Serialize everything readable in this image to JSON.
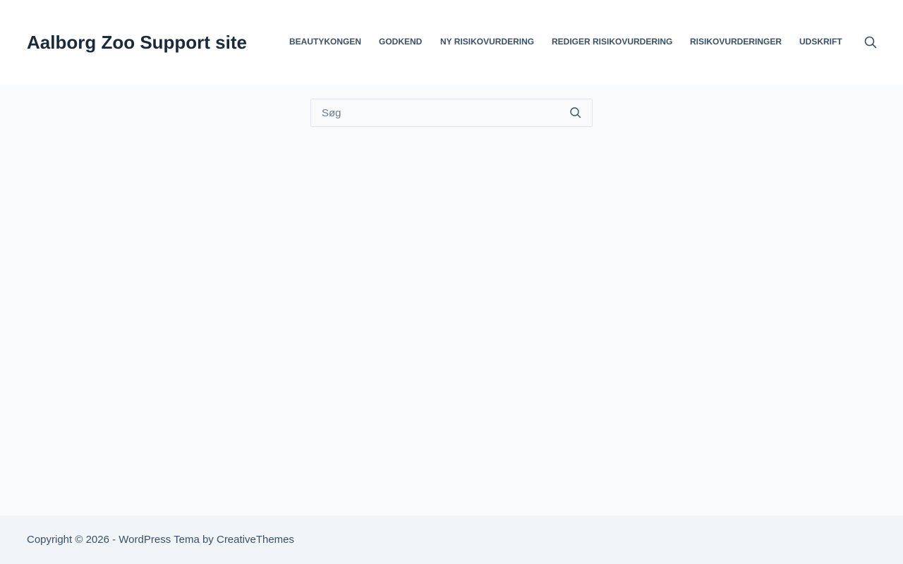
{
  "header": {
    "site_title": "Aalborg Zoo Support site",
    "nav": [
      {
        "label": "BEAUTYKONGEN"
      },
      {
        "label": "GODKEND"
      },
      {
        "label": "NY RISIKOVURDERING"
      },
      {
        "label": "REDIGER RISIKOVURDERING"
      },
      {
        "label": "RISIKOVURDERINGER"
      },
      {
        "label": "UDSKRIFT"
      }
    ],
    "search_icon": "search-icon"
  },
  "main": {
    "search": {
      "placeholder": "Søg",
      "value": "",
      "icon": "search-icon"
    }
  },
  "footer": {
    "copyright_prefix": "Copyright © 2026 - ",
    "wordpress_link": "WordPress Tema",
    "by_text": " by ",
    "creativethemes_link": "CreativeThemes"
  },
  "colors": {
    "title": "#192a3d",
    "text": "#3a4f66",
    "page_bg": "#f8fafc",
    "header_bg": "#ffffff",
    "footer_bg": "#f2f5f7"
  }
}
